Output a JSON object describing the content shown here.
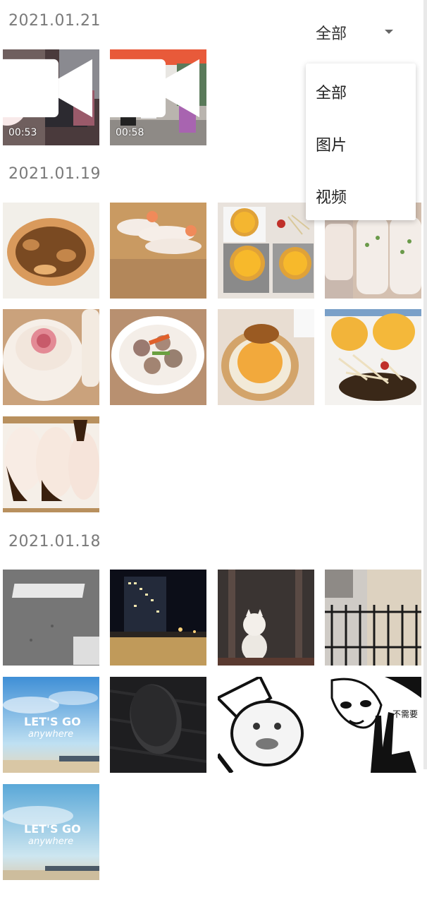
{
  "filter": {
    "label": "全部"
  },
  "menu": {
    "items": [
      {
        "label": "全部"
      },
      {
        "label": "图片"
      },
      {
        "label": "视频"
      }
    ]
  },
  "sections": [
    {
      "date": "2021.01.21",
      "videos": [
        {
          "duration": "00:53"
        },
        {
          "duration": "00:58"
        }
      ]
    },
    {
      "date": "2021.01.19"
    },
    {
      "date": "2021.01.18",
      "texts": {
        "letsgo": "LET'S  GO",
        "anywhere": "anywhere",
        "meme": "不需要"
      }
    }
  ]
}
